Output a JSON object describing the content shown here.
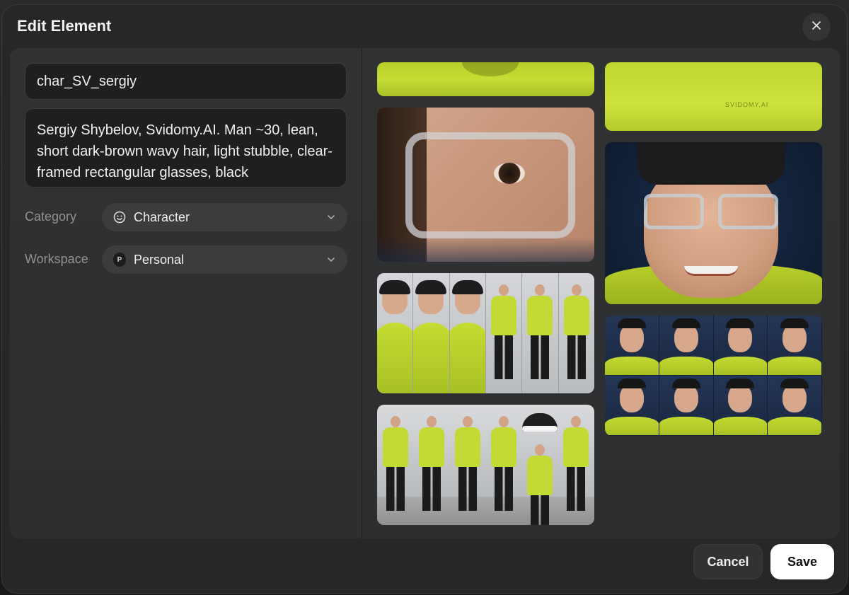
{
  "dialog": {
    "title": "Edit Element",
    "close_icon": "close-icon"
  },
  "form": {
    "name_value": "char_SV_sergiy",
    "description_value": "Sergiy Shybelov, Svidomy.AI. Man ~30, lean, short dark-brown wavy hair, light stubble, clear-framed rectangular glasses, black",
    "category": {
      "label": "Category",
      "icon": "smiley-face-icon",
      "selected": "Character"
    },
    "workspace": {
      "label": "Workspace",
      "badge": "P",
      "selected": "Personal"
    }
  },
  "gallery": {
    "images": [
      {
        "name": "hoodie-collar-closeup"
      },
      {
        "name": "eye-glasses-closeup"
      },
      {
        "name": "character-turnaround-sheet"
      },
      {
        "name": "character-poses-sheet"
      },
      {
        "name": "hoodie-logo-closeup",
        "logo_text": "SVIDOMY.AI"
      },
      {
        "name": "smiling-portrait"
      },
      {
        "name": "facial-expressions-grid"
      }
    ]
  },
  "footer": {
    "cancel_label": "Cancel",
    "save_label": "Save"
  },
  "colors": {
    "modal_bg": "#262728",
    "panel_bg": "#303233",
    "hoodie_accent": "#c4db33",
    "save_button_bg": "#ffffff"
  }
}
